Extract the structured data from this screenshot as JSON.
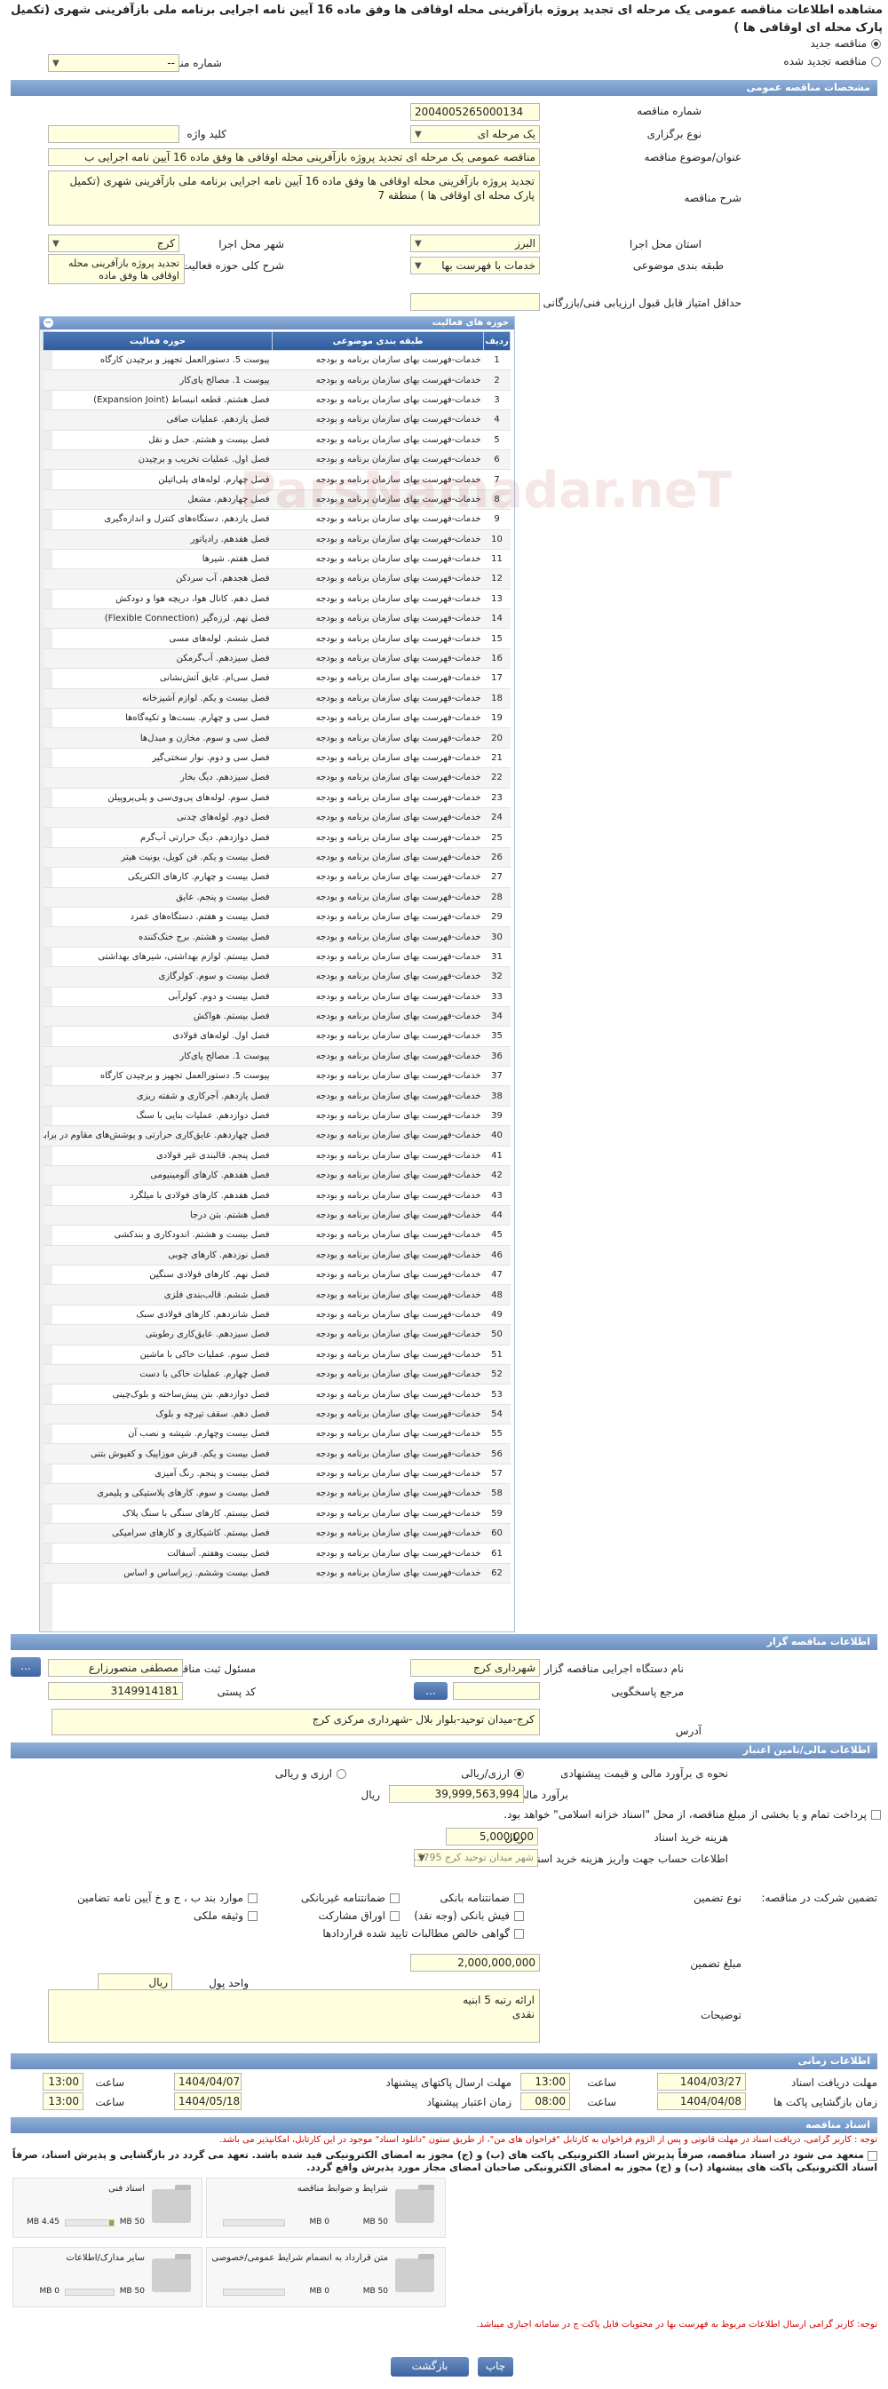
{
  "title": "مشاهده اطلاعات مناقصه عمومی یک مرحله ای تجدید پروژه بازآفرینی محله اوقافی ها وفق ماده 16 آیین نامه اجرایی برنامه ملی بازآفرینی شهری (تکمیل پارک محله ای اوقافی ها )",
  "tender_type": {
    "new": "مناقصه جدید",
    "renewed": "مناقصه تجدید شده",
    "previous_number_label": "شماره مناقصه قبلی",
    "previous_number_value": "--"
  },
  "sections": {
    "general": "مشخصات مناقصه عمومی",
    "categories": "حوزه های فعالیت",
    "organizer": "اطلاعات مناقصه گزار",
    "financial": "اطلاعات مالی/تامین اعتبار",
    "timing": "اطلاعات زمانی",
    "documents": "اسناد مناقصه"
  },
  "general": {
    "number_label": "شماره مناقصه",
    "number": "2004005265000134",
    "held_type_label": "نوع برگزاری",
    "held_type": "یک مرحله ای",
    "keyword_label": "کلید واژه",
    "keyword": "",
    "subject_label": "عنوان/موضوع مناقصه",
    "subject": "مناقصه عمومی یک مرحله ای  تجدید پروژه بازآفرینی محله اوقافی ها وفق ماده 16 آیین نامه اجرایی ب",
    "description_label": "شرح مناقصه",
    "description": "تجدید پروژه بازآفرینی محله اوقافی ها وفق ماده 16 آیین نامه اجرایی برنامه ملی بازآفرینی شهری (تکمیل پارک محله ای اوقافی ها ) منطقه 7",
    "province_label": "استان محل اجرا",
    "province": "البرز",
    "city_label": "شهر محل اجرا",
    "city": "کرج",
    "category_label": "طبقه بندی موضوعی",
    "category": "خدمات با فهرست بها",
    "scope_label": "شرح کلی حوزه فعالیت",
    "scope": "تجدید پروژه بازآفرینی محله اوقافی ها وفق ماده",
    "min_score_label": "حداقل امتیاز قابل قبول ارزیابی فنی/بازرگانی",
    "min_score": ""
  },
  "categories_table": {
    "headers": [
      "ردیف",
      "طبقه بندی موضوعی",
      "حوزه فعالیت"
    ],
    "rows": [
      [
        "1",
        "خدمات-فهرست بهای سازمان برنامه و بودجه",
        "پیوست 5. دستورالعمل تجهیز و برچیدن کارگاه"
      ],
      [
        "2",
        "خدمات-فهرست بهای سازمان برنامه و بودجه",
        "پیوست 1. مصالح پای‌کار"
      ],
      [
        "3",
        "خدمات-فهرست بهای سازمان برنامه و بودجه",
        "فصل هشتم. قطعه انبساط (Expansion Joint)"
      ],
      [
        "4",
        "خدمات-فهرست بهای سازمان برنامه و بودجه",
        "فصل یازدهم. عملیات صافی"
      ],
      [
        "5",
        "خدمات-فهرست بهای سازمان برنامه و بودجه",
        "فصل بیست و هشتم. حمل و نقل"
      ],
      [
        "6",
        "خدمات-فهرست بهای سازمان برنامه و بودجه",
        "فصل اول. عملیات تخریب و برچیدن"
      ],
      [
        "7",
        "خدمات-فهرست بهای سازمان برنامه و بودجه",
        "فصل چهارم. لوله‌های پلی‌اتیلن"
      ],
      [
        "8",
        "خدمات-فهرست بهای سازمان برنامه و بودجه",
        "فصل چهاردهم. مشعل"
      ],
      [
        "9",
        "خدمات-فهرست بهای سازمان برنامه و بودجه",
        "فصل یازدهم. دستگاه‌های کنترل و اندازه‌گیری"
      ],
      [
        "10",
        "خدمات-فهرست بهای سازمان برنامه و بودجه",
        "فصل هفدهم. رادیاتور"
      ],
      [
        "11",
        "خدمات-فهرست بهای سازمان برنامه و بودجه",
        "فصل هفتم. شیرها"
      ],
      [
        "12",
        "خدمات-فهرست بهای سازمان برنامه و بودجه",
        "فصل هجدهم. آب سردکن"
      ],
      [
        "13",
        "خدمات-فهرست بهای سازمان برنامه و بودجه",
        "فصل دهم. کانال هوا، دریچه هوا و دودکش"
      ],
      [
        "14",
        "خدمات-فهرست بهای سازمان برنامه و بودجه",
        "فصل نهم. لرزه‌گیر (Flexible Connection)"
      ],
      [
        "15",
        "خدمات-فهرست بهای سازمان برنامه و بودجه",
        "فصل ششم. لوله‌های مسی"
      ],
      [
        "16",
        "خدمات-فهرست بهای سازمان برنامه و بودجه",
        "فصل سیزدهم. آب‌گرمکن"
      ],
      [
        "17",
        "خدمات-فهرست بهای سازمان برنامه و بودجه",
        "فصل سی‌ام. عایق آتش‌نشانی"
      ],
      [
        "18",
        "خدمات-فهرست بهای سازمان برنامه و بودجه",
        "فصل بیست و یکم. لوازم آشپزخانه"
      ],
      [
        "19",
        "خدمات-فهرست بهای سازمان برنامه و بودجه",
        "فصل سی و چهارم. بست‌ها و تکیه‌گاه‌ها"
      ],
      [
        "20",
        "خدمات-فهرست بهای سازمان برنامه و بودجه",
        "فصل سی و سوم. مخازن و مبدل‌ها"
      ],
      [
        "21",
        "خدمات-فهرست بهای سازمان برنامه و بودجه",
        "فصل سی و دوم. نوار سختی‌گیر"
      ],
      [
        "22",
        "خدمات-فهرست بهای سازمان برنامه و بودجه",
        "فصل سیزدهم. دیگ بخار"
      ],
      [
        "23",
        "خدمات-فهرست بهای سازمان برنامه و بودجه",
        "فصل سوم. لوله‌های پی‌وی‌سی و پلی‌پروپیلن"
      ],
      [
        "24",
        "خدمات-فهرست بهای سازمان برنامه و بودجه",
        "فصل دوم. لوله‌های چدنی"
      ],
      [
        "25",
        "خدمات-فهرست بهای سازمان برنامه و بودجه",
        "فصل دوازدهم. دیگ حرارتی آب‌گرم"
      ],
      [
        "26",
        "خدمات-فهرست بهای سازمان برنامه و بودجه",
        "فصل بیست و یکم. فن کویل، یونیت هیتر"
      ],
      [
        "27",
        "خدمات-فهرست بهای سازمان برنامه و بودجه",
        "فصل بیست و چهارم. کارهای الکتریکی"
      ],
      [
        "28",
        "خدمات-فهرست بهای سازمان برنامه و بودجه",
        "فصل بیست و پنجم. عایق"
      ],
      [
        "29",
        "خدمات-فهرست بهای سازمان برنامه و بودجه",
        "فصل بیست و هفتم. دستگاه‌های عمرد"
      ],
      [
        "30",
        "خدمات-فهرست بهای سازمان برنامه و بودجه",
        "فصل بیست و هشتم. برج خنک‌کننده"
      ],
      [
        "31",
        "خدمات-فهرست بهای سازمان برنامه و بودجه",
        "فصل بیستم. لوازم بهداشتی، شیرهای بهداشتی"
      ],
      [
        "32",
        "خدمات-فهرست بهای سازمان برنامه و بودجه",
        "فصل بیست و سوم. کولرگازی"
      ],
      [
        "33",
        "خدمات-فهرست بهای سازمان برنامه و بودجه",
        "فصل بیست و دوم. کولرآبی"
      ],
      [
        "34",
        "خدمات-فهرست بهای سازمان برنامه و بودجه",
        "فصل بیستم. هواکش"
      ],
      [
        "35",
        "خدمات-فهرست بهای سازمان برنامه و بودجه",
        "فصل اول. لوله‌های فولادی"
      ],
      [
        "36",
        "خدمات-فهرست بهای سازمان برنامه و بودجه",
        "پیوست 1. مصالح پای‌کار"
      ],
      [
        "37",
        "خدمات-فهرست بهای سازمان برنامه و بودجه",
        "پیوست 5. دستورالعمل تجهیز و برچیدن کارگاه"
      ],
      [
        "38",
        "خدمات-فهرست بهای سازمان برنامه و بودجه",
        "فصل یازدهم. آجرکاری و شفته ریزی"
      ],
      [
        "39",
        "خدمات-فهرست بهای سازمان برنامه و بودجه",
        "فصل دوازدهم. عملیات بنایی با سنگ"
      ],
      [
        "40",
        "خدمات-فهرست بهای سازمان برنامه و بودجه",
        "فصل چهاردهم. عایق‌کاری حرارتی و پوشش‌های مقاوم در برابر آتش"
      ],
      [
        "41",
        "خدمات-فهرست بهای سازمان برنامه و بودجه",
        "فصل پنجم. قالبندی غیر فولادی"
      ],
      [
        "42",
        "خدمات-فهرست بهای سازمان برنامه و بودجه",
        "فصل هفدهم. کارهای آلومینیومی"
      ],
      [
        "43",
        "خدمات-فهرست بهای سازمان برنامه و بودجه",
        "فصل هفدهم. کارهای فولادی با میلگرد"
      ],
      [
        "44",
        "خدمات-فهرست بهای سازمان برنامه و بودجه",
        "فصل هشتم. بتن درجا"
      ],
      [
        "45",
        "خدمات-فهرست بهای سازمان برنامه و بودجه",
        "فصل بیست و هشتم. اندودکاری و بندکشی"
      ],
      [
        "46",
        "خدمات-فهرست بهای سازمان برنامه و بودجه",
        "فصل نوزدهم. کارهای چوبی"
      ],
      [
        "47",
        "خدمات-فهرست بهای سازمان برنامه و بودجه",
        "فصل نهم. کارهای فولادی سنگین"
      ],
      [
        "48",
        "خدمات-فهرست بهای سازمان برنامه و بودجه",
        "فصل ششم. قالب‌بندی فلزی"
      ],
      [
        "49",
        "خدمات-فهرست بهای سازمان برنامه و بودجه",
        "فصل شانزدهم. کارهای فولادی سبک"
      ],
      [
        "50",
        "خدمات-فهرست بهای سازمان برنامه و بودجه",
        "فصل سیزدهم. عایق‌کاری رطوبتی"
      ],
      [
        "51",
        "خدمات-فهرست بهای سازمان برنامه و بودجه",
        "فصل سوم. عملیات خاکی با ماشین"
      ],
      [
        "52",
        "خدمات-فهرست بهای سازمان برنامه و بودجه",
        "فصل چهارم. عملیات خاکی با دست"
      ],
      [
        "53",
        "خدمات-فهرست بهای سازمان برنامه و بودجه",
        "فصل دوازدهم. بتن پیش‌ساخته و بلوک‌چینی"
      ],
      [
        "54",
        "خدمات-فهرست بهای سازمان برنامه و بودجه",
        "فصل دهم. سقف تیرچه و بلوک"
      ],
      [
        "55",
        "خدمات-فهرست بهای سازمان برنامه و بودجه",
        "فصل بیست وچهارم. شیشه و نصب آن"
      ],
      [
        "56",
        "خدمات-فهرست بهای سازمان برنامه و بودجه",
        "فصل بیست و یکم. فرش موزاییک و کفپوش بتنی"
      ],
      [
        "57",
        "خدمات-فهرست بهای سازمان برنامه و بودجه",
        "فصل بیست و پنجم. رنگ آمیزی"
      ],
      [
        "58",
        "خدمات-فهرست بهای سازمان برنامه و بودجه",
        "فصل بیست و سوم. کارهای پلاستیکی و پلیمری"
      ],
      [
        "59",
        "خدمات-فهرست بهای سازمان برنامه و بودجه",
        "فصل بیستم. کارهای سنگی با سنگ پلاک"
      ],
      [
        "60",
        "خدمات-فهرست بهای سازمان برنامه و بودجه",
        "فصل بیستم. کاشیکاری و کارهای سرامیکی"
      ],
      [
        "61",
        "خدمات-فهرست بهای سازمان برنامه و بودجه",
        "فصل بیست وهفتم. آسفالت"
      ],
      [
        "62",
        "خدمات-فهرست بهای سازمان برنامه و بودجه",
        "فصل بیست وششم. زیراساس و اساس"
      ]
    ]
  },
  "organizer": {
    "device_label": "نام دستگاه اجرایی مناقصه گزار",
    "device": "شهرداری کرج",
    "responsible_label": "مسئول ثبت مناقصه",
    "responsible": "مصطفی منصورزارع",
    "reference_label": "مرجع پاسخگویی",
    "reference": "",
    "postal_label": "کد پستی",
    "postal": "3149914181",
    "address_label": "آدرس",
    "address": "کرج-میدان توحید-بلوار بلال -شهرداری مرکزی کرج",
    "dots": "..."
  },
  "financial": {
    "method_label": "نحوه ی برآورد مالی و قیمت پیشنهادی",
    "method_rial": "ارزی/ریالی",
    "method_fx": "ارزی و ریالی",
    "estimate_label": "برآورد مالی",
    "estimate": "39,999,563,994",
    "currency": "ریال",
    "payment_note": "پرداخت تمام و یا بخشی از مبلغ مناقصه، از محل \"اسناد خزانه اسلامی\" خواهد بود.",
    "doc_fee_label": "هزینه خرید اسناد",
    "doc_fee": "5,000,000",
    "doc_fee_currency": "ریال",
    "account_label": "اطلاعات حساب جهت واریز هزینه خرید اسناد",
    "account": "شهر میدان توحید کرج 3795...",
    "guarantee_label": "تضمین شرکت در مناقصه:",
    "guarantee_type_label": "نوع تضمین",
    "guarantee_options": [
      "ضمانتنامه بانکی",
      "ضمانتنامه غیربانکی",
      "موارد بند ب ، ج و خ آیین نامه تضامین",
      "فیش بانکی (وجه نقد)",
      "اوراق مشارکت",
      "وثیقه ملکی",
      "گواهی خالص مطالبات تایید شده قراردادها"
    ],
    "amount_label": "مبلغ تضمین",
    "amount": "2,000,000,000",
    "unit_label": "واحد پول",
    "unit": "ریال",
    "notes_label": "توضیحات",
    "notes": "ارائه رتبه 5 ابنیه\nنقدی"
  },
  "timing": {
    "doc_receive_label": "مهلت دریافت اسناد",
    "doc_receive_date": "1404/03/27",
    "doc_receive_time": "13:00",
    "submit_label": "مهلت ارسال پاکتهای پیشنهاد",
    "submit_date": "1404/04/07",
    "submit_time": "13:00",
    "open_label": "زمان بازگشایی پاکت ها",
    "open_date": "1404/04/08",
    "open_time": "08:00",
    "validity_label": "زمان اعتبار پیشنهاد",
    "validity_date": "1404/05/18",
    "validity_time": "13:00",
    "time_label": "ساعت"
  },
  "documents": {
    "note1": "توجه : کاربر گرامی، دریافت اسناد در مهلت قانونی و پس از الزوم فراخوان به کارتابل \"فراخوان های من\"، از طریق ستون \"دانلود اسناد\" موجود در این کارتابل، امکانپذیر می باشد.",
    "note2": "منعهد می شود در اسناد مناقصه، صرفاً پذیرش اسناد الکترونیکی پاکت های (ب) و (ج) مجوز به امضای الکترونیکی قید شده باشد. تعهد می گردد در بازگشایی و پذیرش اسناد، صرفاً اسناد الکترونیکی پاکت های پیشنهاد (ب) و (ج) مجوز به امضای الکترونیکی صاحبان امضای مجاز مورد پذیرش واقع گردد.",
    "files": [
      {
        "name": "شرایط و ضوابط مناقصه",
        "size": "0 MB",
        "max": "50 MB",
        "fill": 0
      },
      {
        "name": "اسناد فنی",
        "size": "4.45 MB",
        "max": "50 MB",
        "fill": 0.09
      },
      {
        "name": "متن قرارداد به انضمام شرایط عمومی/خصوصی",
        "size": "0 MB",
        "max": "50 MB",
        "fill": 0
      },
      {
        "name": "سایر مدارک/اطلاعات",
        "size": "0 MB",
        "max": "50 MB",
        "fill": 0
      }
    ],
    "note3": "توجه: کاربر گرامی ارسال اطلاعات مربوط به فهرست بها در محتویات فایل پاکت ج در سامانه اجباری میباشد."
  },
  "footer": {
    "print": "چاپ",
    "back": "بازگشت"
  },
  "watermark": "ParsNamadar.neT"
}
